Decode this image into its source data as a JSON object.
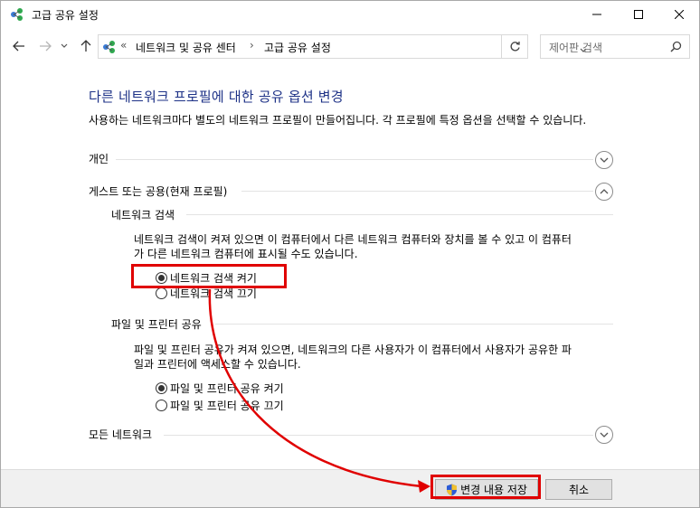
{
  "window": {
    "title": "고급 공유 설정"
  },
  "nav": {
    "breadcrumb_prefix": "«",
    "crumbs": [
      "네트워크 및 공유 센터",
      "고급 공유 설정"
    ],
    "separator": "›",
    "search_placeholder": "제어판 검색"
  },
  "page": {
    "title": "다른 네트워크 프로필에 대한 공유 옵션 변경",
    "description": "사용하는 네트워크마다 별도의 네트워크 프로필이 만들어집니다. 각 프로필에 특정 옵션을 선택할 수 있습니다."
  },
  "sections": {
    "private": {
      "label": "개인"
    },
    "guest": {
      "label": "게스트 또는 공용(현재 프로필)"
    },
    "all": {
      "label": "모든 네트워크"
    }
  },
  "discovery": {
    "heading": "네트워크 검색",
    "text_line1": "네트워크 검색이 켜져 있으면 이 컴퓨터에서 다른 네트워크 컴퓨터와 장치를 볼 수 있고 이 컴퓨터",
    "text_line2": "가 다른 네트워크 컴퓨터에 표시될 수도 있습니다.",
    "on_label": "네트워크 검색 켜기",
    "off_label": "네트워크 검색 끄기",
    "selected": "on"
  },
  "filesharing": {
    "heading": "파일 및 프린터 공유",
    "text_line1": "파일 및 프린터 공유가 켜져 있으면, 네트워크의 다른 사용자가 이 컴퓨터에서 사용자가 공유한 파",
    "text_line2": "일과 프린터에 액세스할 수 있습니다.",
    "on_label": "파일 및 프린터 공유 켜기",
    "off_label": "파일 및 프린터 공유 끄기",
    "selected": "on"
  },
  "footer": {
    "save_label": "변경 내용 저장",
    "cancel_label": "취소"
  },
  "colors": {
    "title_blue": "#1e3287",
    "highlight_red": "#e00000"
  }
}
